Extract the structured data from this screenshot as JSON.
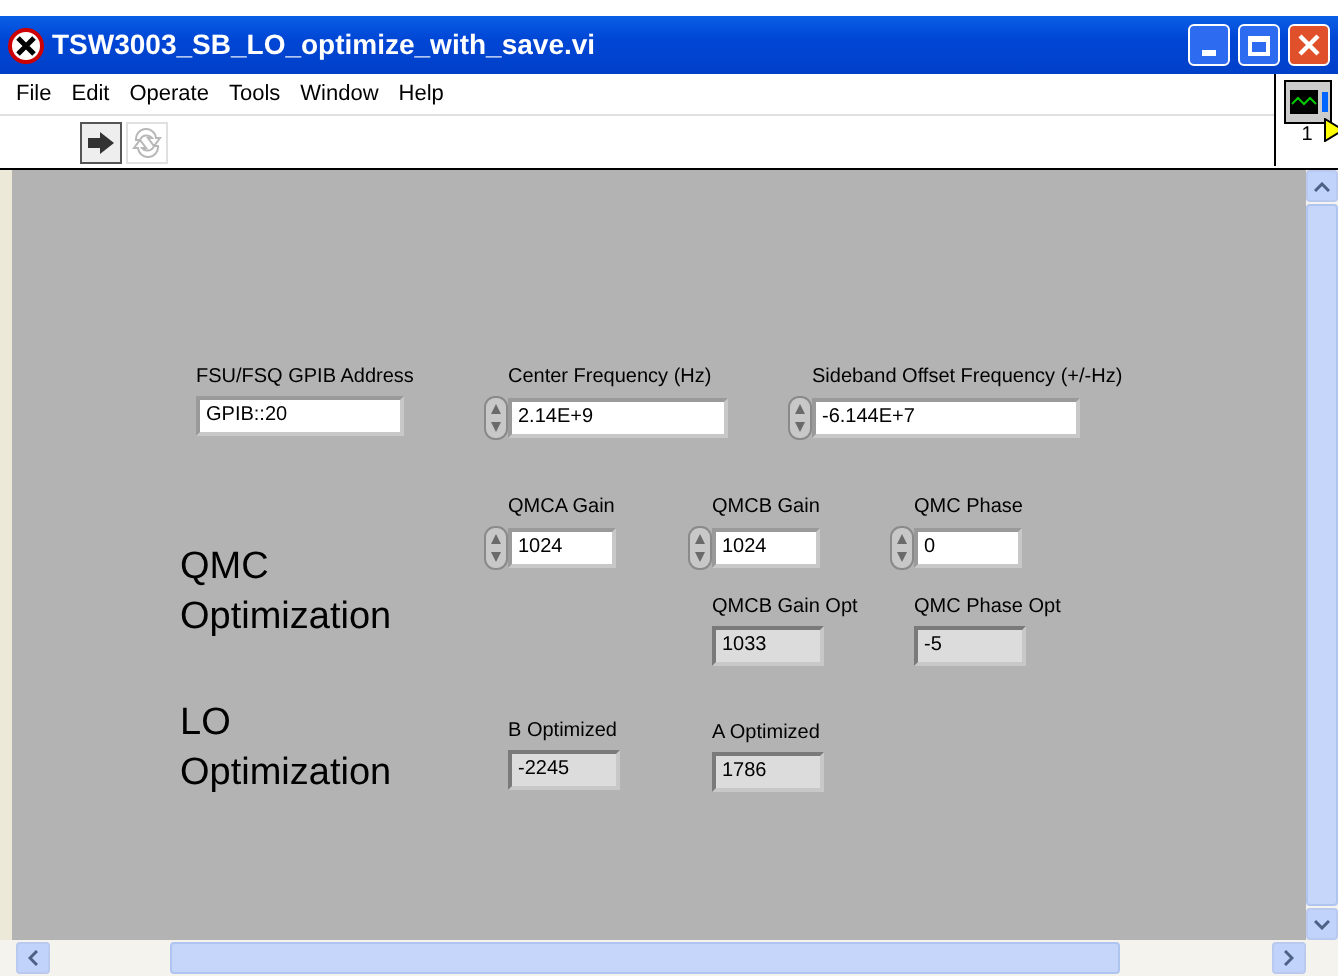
{
  "window": {
    "title": "TSW3003_SB_LO_optimize_with_save.vi"
  },
  "menu": [
    "File",
    "Edit",
    "Operate",
    "Tools",
    "Window",
    "Help"
  ],
  "toolbar": [
    {
      "kind": "run",
      "disabled": false
    },
    {
      "kind": "run-continuous",
      "disabled": true
    }
  ],
  "vi_icon": {
    "label": "1"
  },
  "headings": [
    "QMC Optimization",
    "LO Optimization"
  ],
  "controls": [
    {
      "label": "FSU/FSQ GPIB Address",
      "value": "GPIB::20",
      "kind": "string"
    },
    {
      "label": "Center Frequency (Hz)",
      "value": "2.14E+9",
      "kind": "numeric"
    },
    {
      "label": "Sideband Offset Frequency (+/-Hz)",
      "value": "-6.144E+7",
      "kind": "numeric"
    },
    {
      "label": "QMCA Gain",
      "value": "1024",
      "kind": "numeric"
    },
    {
      "label": "QMCB Gain",
      "value": "1024",
      "kind": "numeric"
    },
    {
      "label": "QMC Phase",
      "value": "0",
      "kind": "numeric"
    },
    {
      "label": "QMCB Gain Opt",
      "value": "1033",
      "kind": "indicator"
    },
    {
      "label": "QMC Phase Opt",
      "value": "-5",
      "kind": "indicator"
    },
    {
      "label": "B Optimized",
      "value": "-2245",
      "kind": "indicator"
    },
    {
      "label": "A Optimized",
      "value": "1786",
      "kind": "indicator"
    }
  ]
}
